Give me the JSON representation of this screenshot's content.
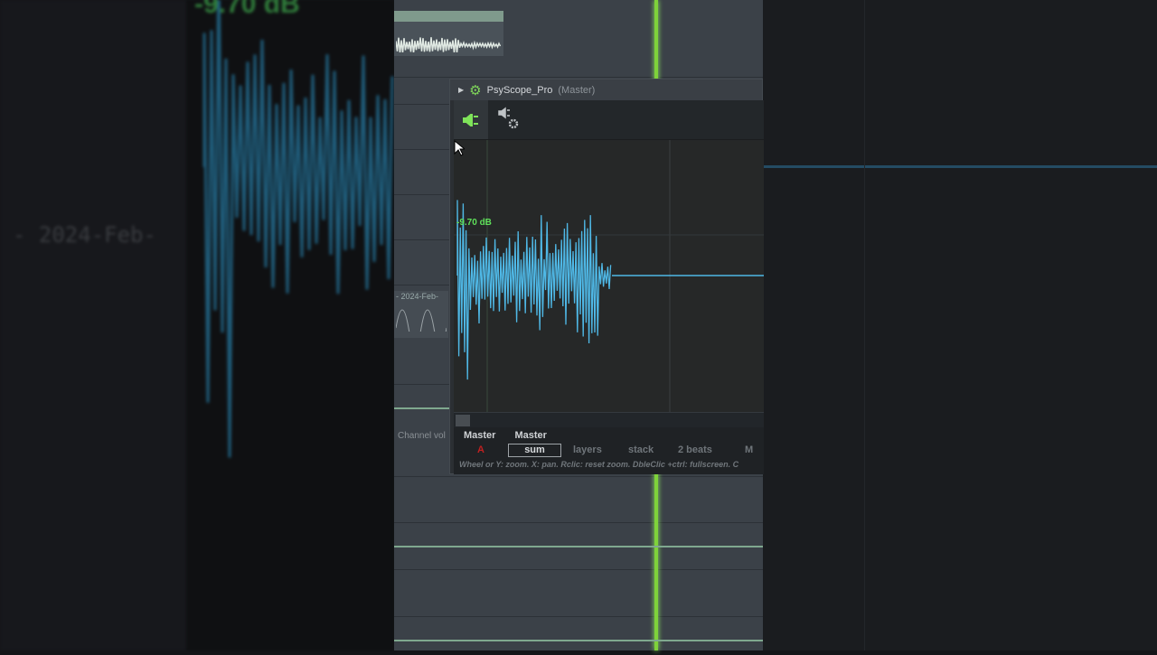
{
  "background": {
    "left_db_readout": "-9.70 dB",
    "left_clip_date": "- 2024-Feb-",
    "center_clip_date": "- 2024-Feb-",
    "channel_vol_label": "Channel vol"
  },
  "plugin": {
    "title": "PsyScope_Pro",
    "title_context": "(Master)",
    "icons": {
      "expand": "triangle-right-icon",
      "settings": "gear-icon",
      "plug_active": "plug-icon",
      "plug_settings": "plug-gear-icon"
    },
    "scope": {
      "db_readout": "-9.70 dB",
      "waveform_color": "#4fb8e6",
      "readout_color": "#5fe05a"
    },
    "footer": {
      "input_names": [
        "Master",
        "Master"
      ],
      "marker": "A",
      "modes": {
        "sum": "sum",
        "layers": "layers",
        "stack": "stack",
        "length": "2 beats",
        "m": "M"
      },
      "selected_mode": "sum",
      "hint": "Wheel or Y: zoom. X: pan. Rclic: reset zoom. DbleClic +ctrl: fullscreen. C"
    }
  },
  "colors": {
    "playhead": "#7fd33a"
  }
}
